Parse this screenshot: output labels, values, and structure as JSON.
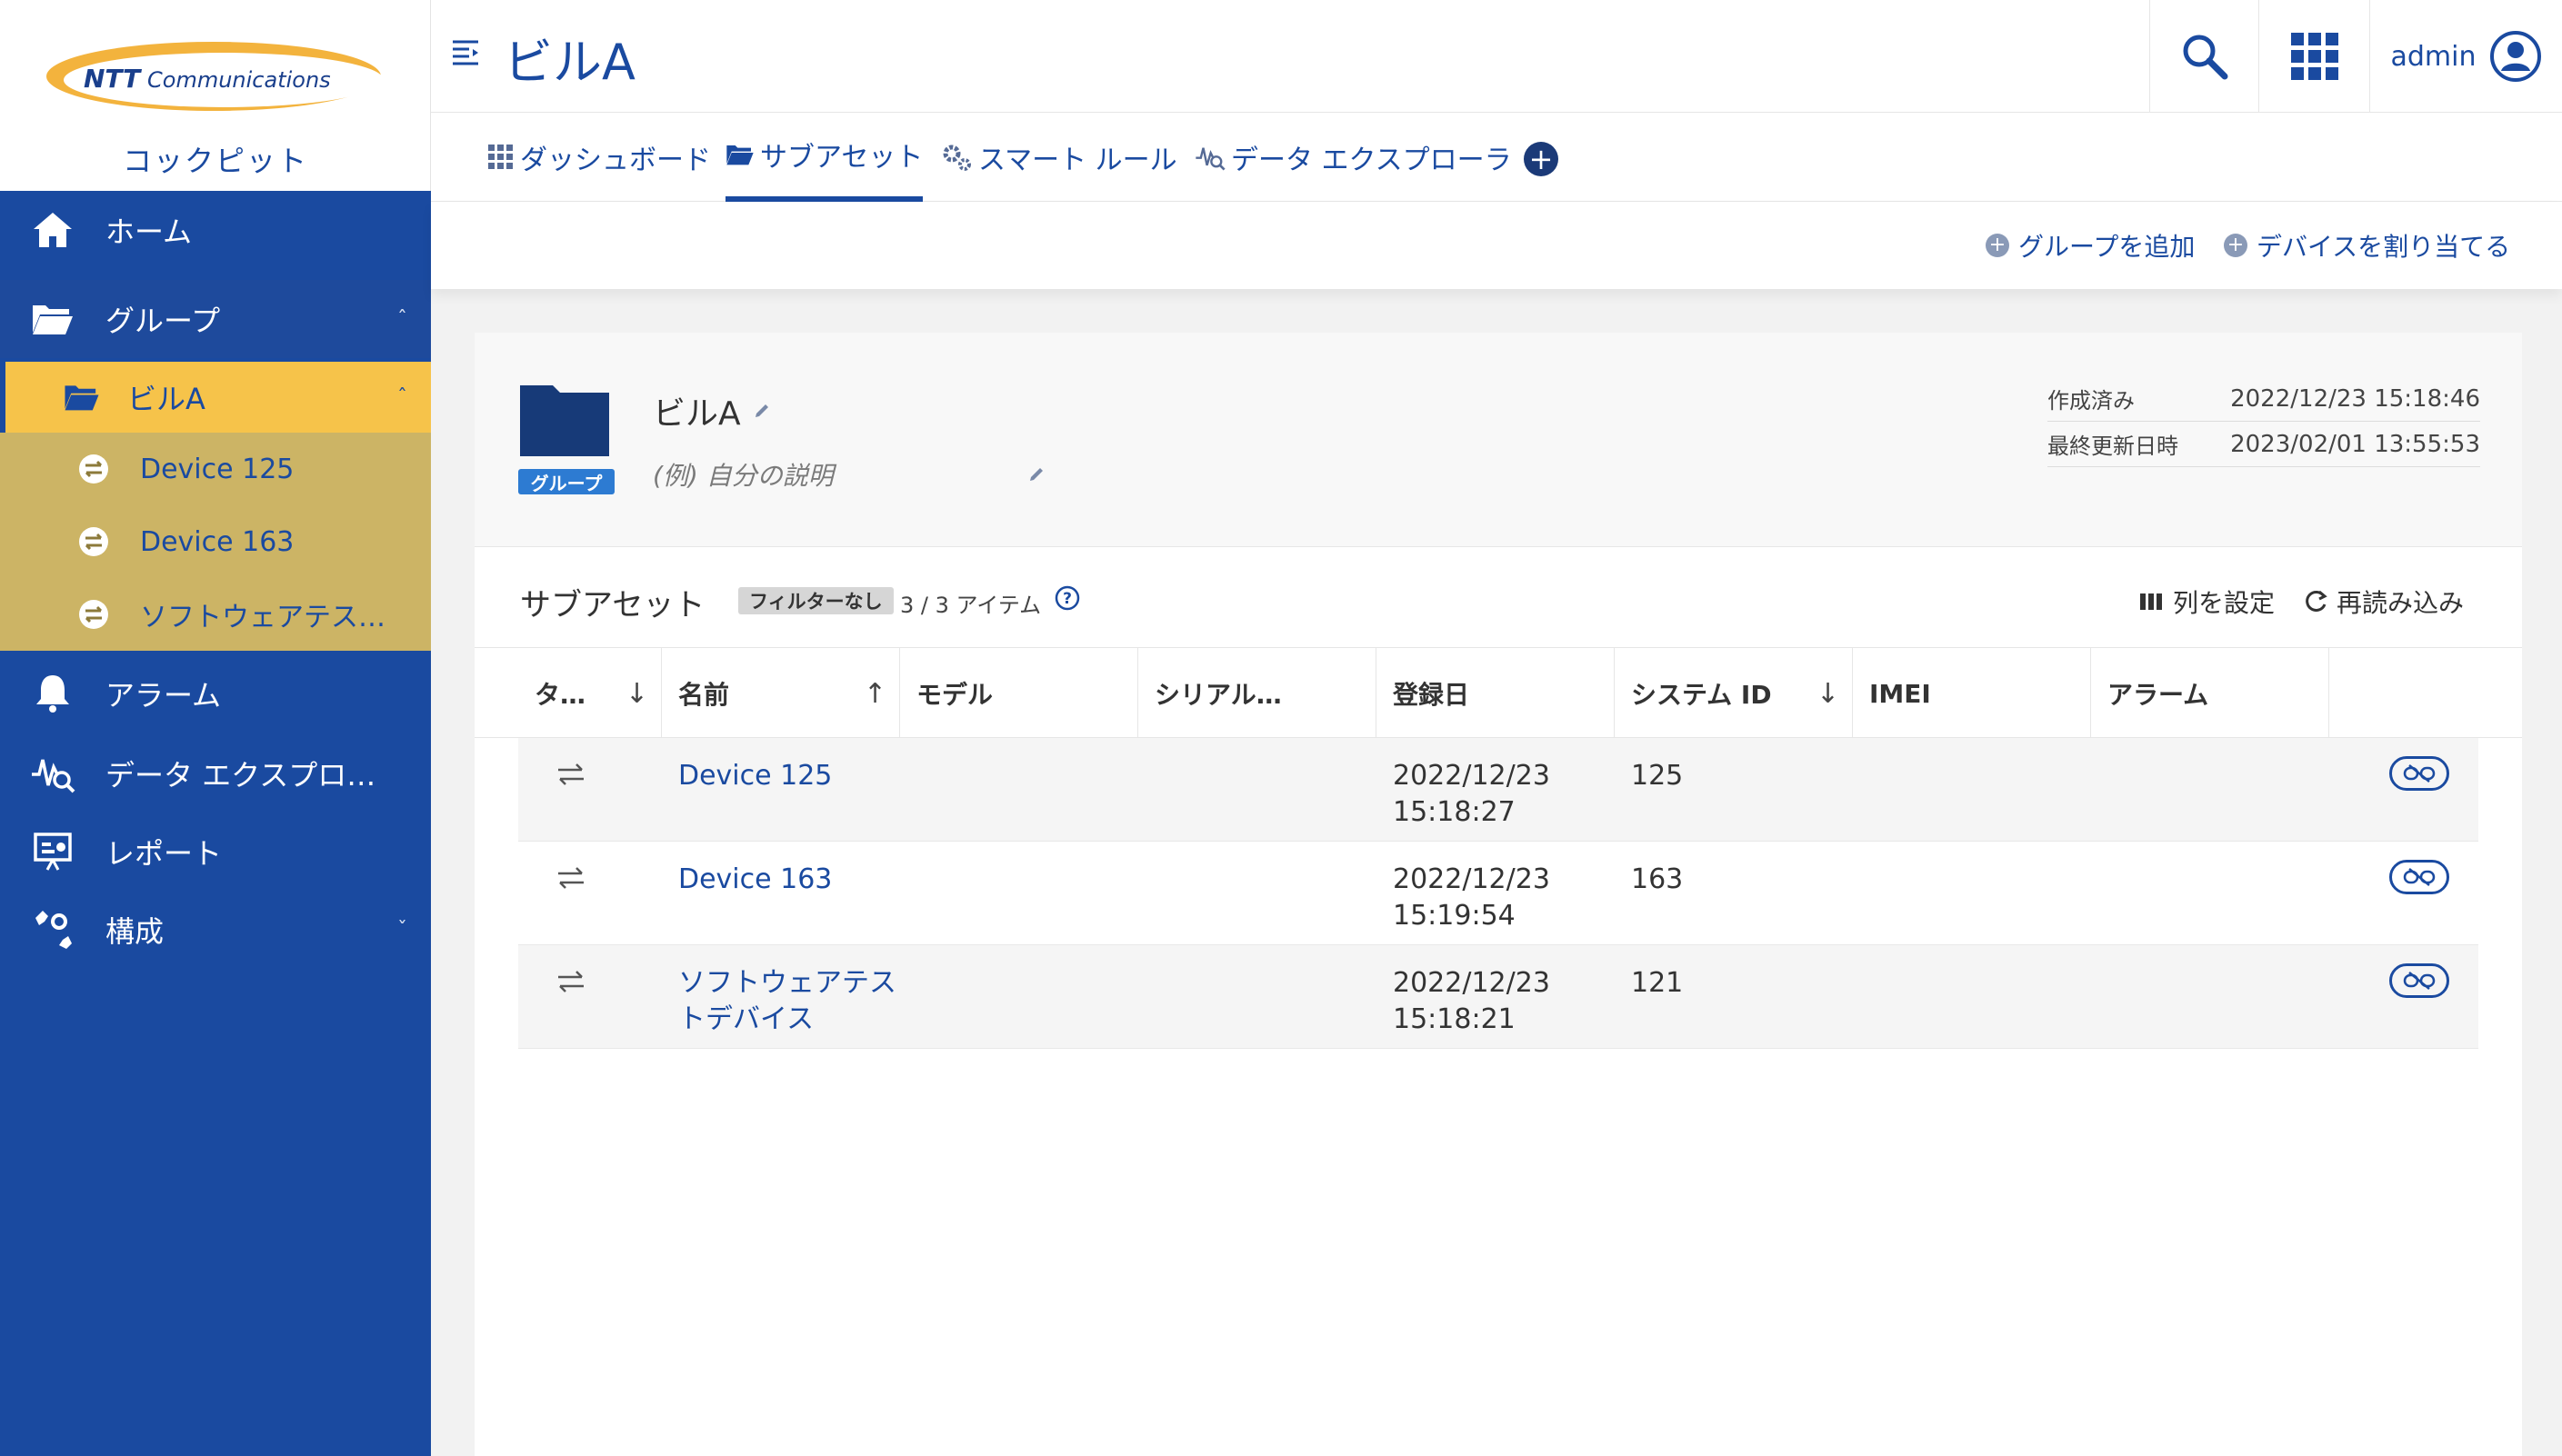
{
  "brand": {
    "logo_text": "NTT Communications",
    "subtitle": "コックピット"
  },
  "sidebar": {
    "home": "ホーム",
    "group": "グループ",
    "bill": "ビルA",
    "children": [
      "Device 125",
      "Device 163",
      "ソフトウェアテス…"
    ],
    "alarm": "アラーム",
    "explorer": "データ エクスプロ…",
    "report": "レポート",
    "config": "構成",
    "chev_up": "ˆ",
    "chev_down": "ˇ"
  },
  "header": {
    "title": "ビルA",
    "user": "admin"
  },
  "tabs": [
    "ダッシュボード",
    "サブアセット",
    "スマート ルール",
    "データ エクスプローラ"
  ],
  "tab_add": "+",
  "actions": {
    "add_group": "グループを追加",
    "assign_device": "デバイスを割り当てる",
    "plus": "+"
  },
  "group": {
    "name": "ビルA",
    "badge": "グループ",
    "description": "(例) 自分の説明",
    "created_label": "作成済み",
    "created_value": "2022/12/23 15:18:46",
    "updated_label": "最終更新日時",
    "updated_value": "2023/02/01 13:55:53"
  },
  "subassets": {
    "title": "サブアセット",
    "filter": "フィルターなし",
    "count": "3 / 3 アイテム",
    "columns_btn": "列を設定",
    "reload_btn": "再読み込み"
  },
  "table": {
    "headers": [
      "タ…",
      "名前",
      "モデル",
      "シリアル…",
      "登録日",
      "システム ID",
      "IMEI",
      "アラーム"
    ],
    "sort_down": "↓",
    "sort_up": "↑",
    "rows": [
      {
        "name_l1": "Device 125",
        "name_l2": "",
        "date_l1": "2022/12/23",
        "date_l2": "15:18:27",
        "system_id": "125"
      },
      {
        "name_l1": "Device 163",
        "name_l2": "",
        "date_l1": "2022/12/23",
        "date_l2": "15:19:54",
        "system_id": "163"
      },
      {
        "name_l1": "ソフトウェアテス",
        "name_l2": "トデバイス",
        "date_l1": "2022/12/23",
        "date_l2": "15:18:21",
        "system_id": "121"
      }
    ]
  },
  "colors": {
    "primary": "#1a4aa0",
    "highlight": "#f6c34a",
    "submenu": "#ccb465"
  }
}
